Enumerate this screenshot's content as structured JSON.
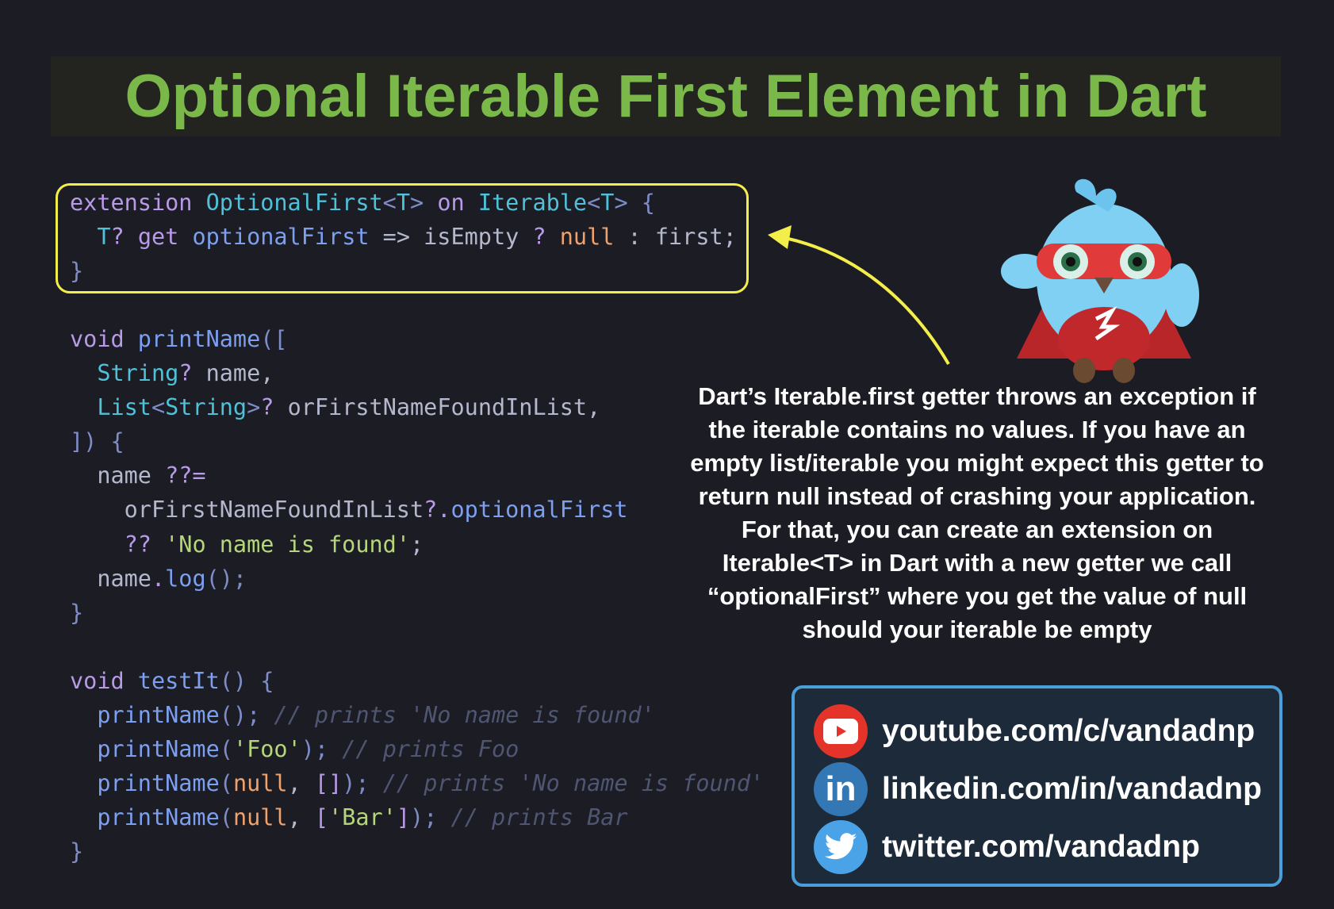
{
  "title": "Optional Iterable First Element in Dart",
  "colors": {
    "title": "#7bb84a",
    "highlight_border": "#f4ee4a",
    "arrow": "#f4ee4a",
    "social_border": "#4a9fd8",
    "youtube": "#e4342a",
    "linkedin": "#3477b5",
    "twitter": "#4aa3e6"
  },
  "code_highlighted": [
    [
      [
        "kw",
        "extension "
      ],
      [
        "ty",
        "OptionalFirst"
      ],
      [
        "pu",
        "<"
      ],
      [
        "ty",
        "T"
      ],
      [
        "pu",
        "> "
      ],
      [
        "kw",
        "on "
      ],
      [
        "ty",
        "Iterable"
      ],
      [
        "pu",
        "<"
      ],
      [
        "ty",
        "T"
      ],
      [
        "pu",
        "> {"
      ]
    ],
    [
      [
        "op",
        "  "
      ],
      [
        "ty",
        "T"
      ],
      [
        "kw",
        "? get "
      ],
      [
        "fn",
        "optionalFirst"
      ],
      [
        "op",
        " => isEmpty "
      ],
      [
        "kw",
        "? "
      ],
      [
        "nu",
        "null"
      ],
      [
        "op",
        " : first;"
      ]
    ],
    [
      [
        "pu",
        "}"
      ]
    ]
  ],
  "code_main": [
    [
      [
        "kw",
        "void "
      ],
      [
        "fn",
        "printName"
      ],
      [
        "pu",
        "(["
      ]
    ],
    [
      [
        "op",
        "  "
      ],
      [
        "ty",
        "String"
      ],
      [
        "kw",
        "?"
      ],
      [
        "op",
        " name,"
      ]
    ],
    [
      [
        "op",
        "  "
      ],
      [
        "ty",
        "List"
      ],
      [
        "pu",
        "<"
      ],
      [
        "ty",
        "String"
      ],
      [
        "pu",
        ">"
      ],
      [
        "kw",
        "?"
      ],
      [
        "op",
        " orFirstNameFoundInList,"
      ]
    ],
    [
      [
        "pu",
        "]) {"
      ]
    ],
    [
      [
        "op",
        "  name "
      ],
      [
        "kw",
        "??="
      ]
    ],
    [
      [
        "op",
        "    orFirstNameFoundInList"
      ],
      [
        "kw",
        "?."
      ],
      [
        "fn",
        "optionalFirst"
      ]
    ],
    [
      [
        "op",
        "    "
      ],
      [
        "kw",
        "?? "
      ],
      [
        "st",
        "'No name is found'"
      ],
      [
        "op",
        ";"
      ]
    ],
    [
      [
        "op",
        "  name"
      ],
      [
        "kw",
        "."
      ],
      [
        "fn",
        "log"
      ],
      [
        "pu",
        "();"
      ]
    ],
    [
      [
        "pu",
        "}"
      ]
    ],
    [
      [
        "op",
        " "
      ]
    ],
    [
      [
        "kw",
        "void "
      ],
      [
        "fn",
        "testIt"
      ],
      [
        "pu",
        "() {"
      ]
    ],
    [
      [
        "op",
        "  "
      ],
      [
        "fn",
        "printName"
      ],
      [
        "pu",
        "();"
      ],
      [
        "cm",
        " // prints 'No name is found'"
      ]
    ],
    [
      [
        "op",
        "  "
      ],
      [
        "fn",
        "printName"
      ],
      [
        "pu",
        "("
      ],
      [
        "st",
        "'Foo'"
      ],
      [
        "pu",
        ");"
      ],
      [
        "cm",
        " // prints Foo"
      ]
    ],
    [
      [
        "op",
        "  "
      ],
      [
        "fn",
        "printName"
      ],
      [
        "pu",
        "("
      ],
      [
        "nu",
        "null"
      ],
      [
        "op",
        ", "
      ],
      [
        "kw",
        "[]"
      ],
      [
        "pu",
        ");"
      ],
      [
        "cm",
        " // prints 'No name is found'"
      ]
    ],
    [
      [
        "op",
        "  "
      ],
      [
        "fn",
        "printName"
      ],
      [
        "pu",
        "("
      ],
      [
        "nu",
        "null"
      ],
      [
        "op",
        ", "
      ],
      [
        "kw",
        "["
      ],
      [
        "st",
        "'Bar'"
      ],
      [
        "kw",
        "]"
      ],
      [
        "pu",
        ");"
      ],
      [
        "cm",
        " // prints Bar"
      ]
    ],
    [
      [
        "pu",
        "}"
      ]
    ]
  ],
  "description": [
    "Dart’s Iterable.first getter throws an exception if",
    "the iterable contains no values. If you have an",
    "empty list/iterable you might expect this getter to",
    "return null instead of crashing your application.",
    "For that, you can create an extension on",
    "Iterable<T> in Dart with a new getter we call",
    "“optionalFirst” where you get the value of null",
    "should your iterable be empty"
  ],
  "social": [
    {
      "icon": "youtube-icon",
      "label": "youtube.com/c/vandadnp"
    },
    {
      "icon": "linkedin-icon",
      "label": "linkedin.com/in/vandadnp"
    },
    {
      "icon": "twitter-icon",
      "label": "twitter.com/vandadnp"
    }
  ]
}
